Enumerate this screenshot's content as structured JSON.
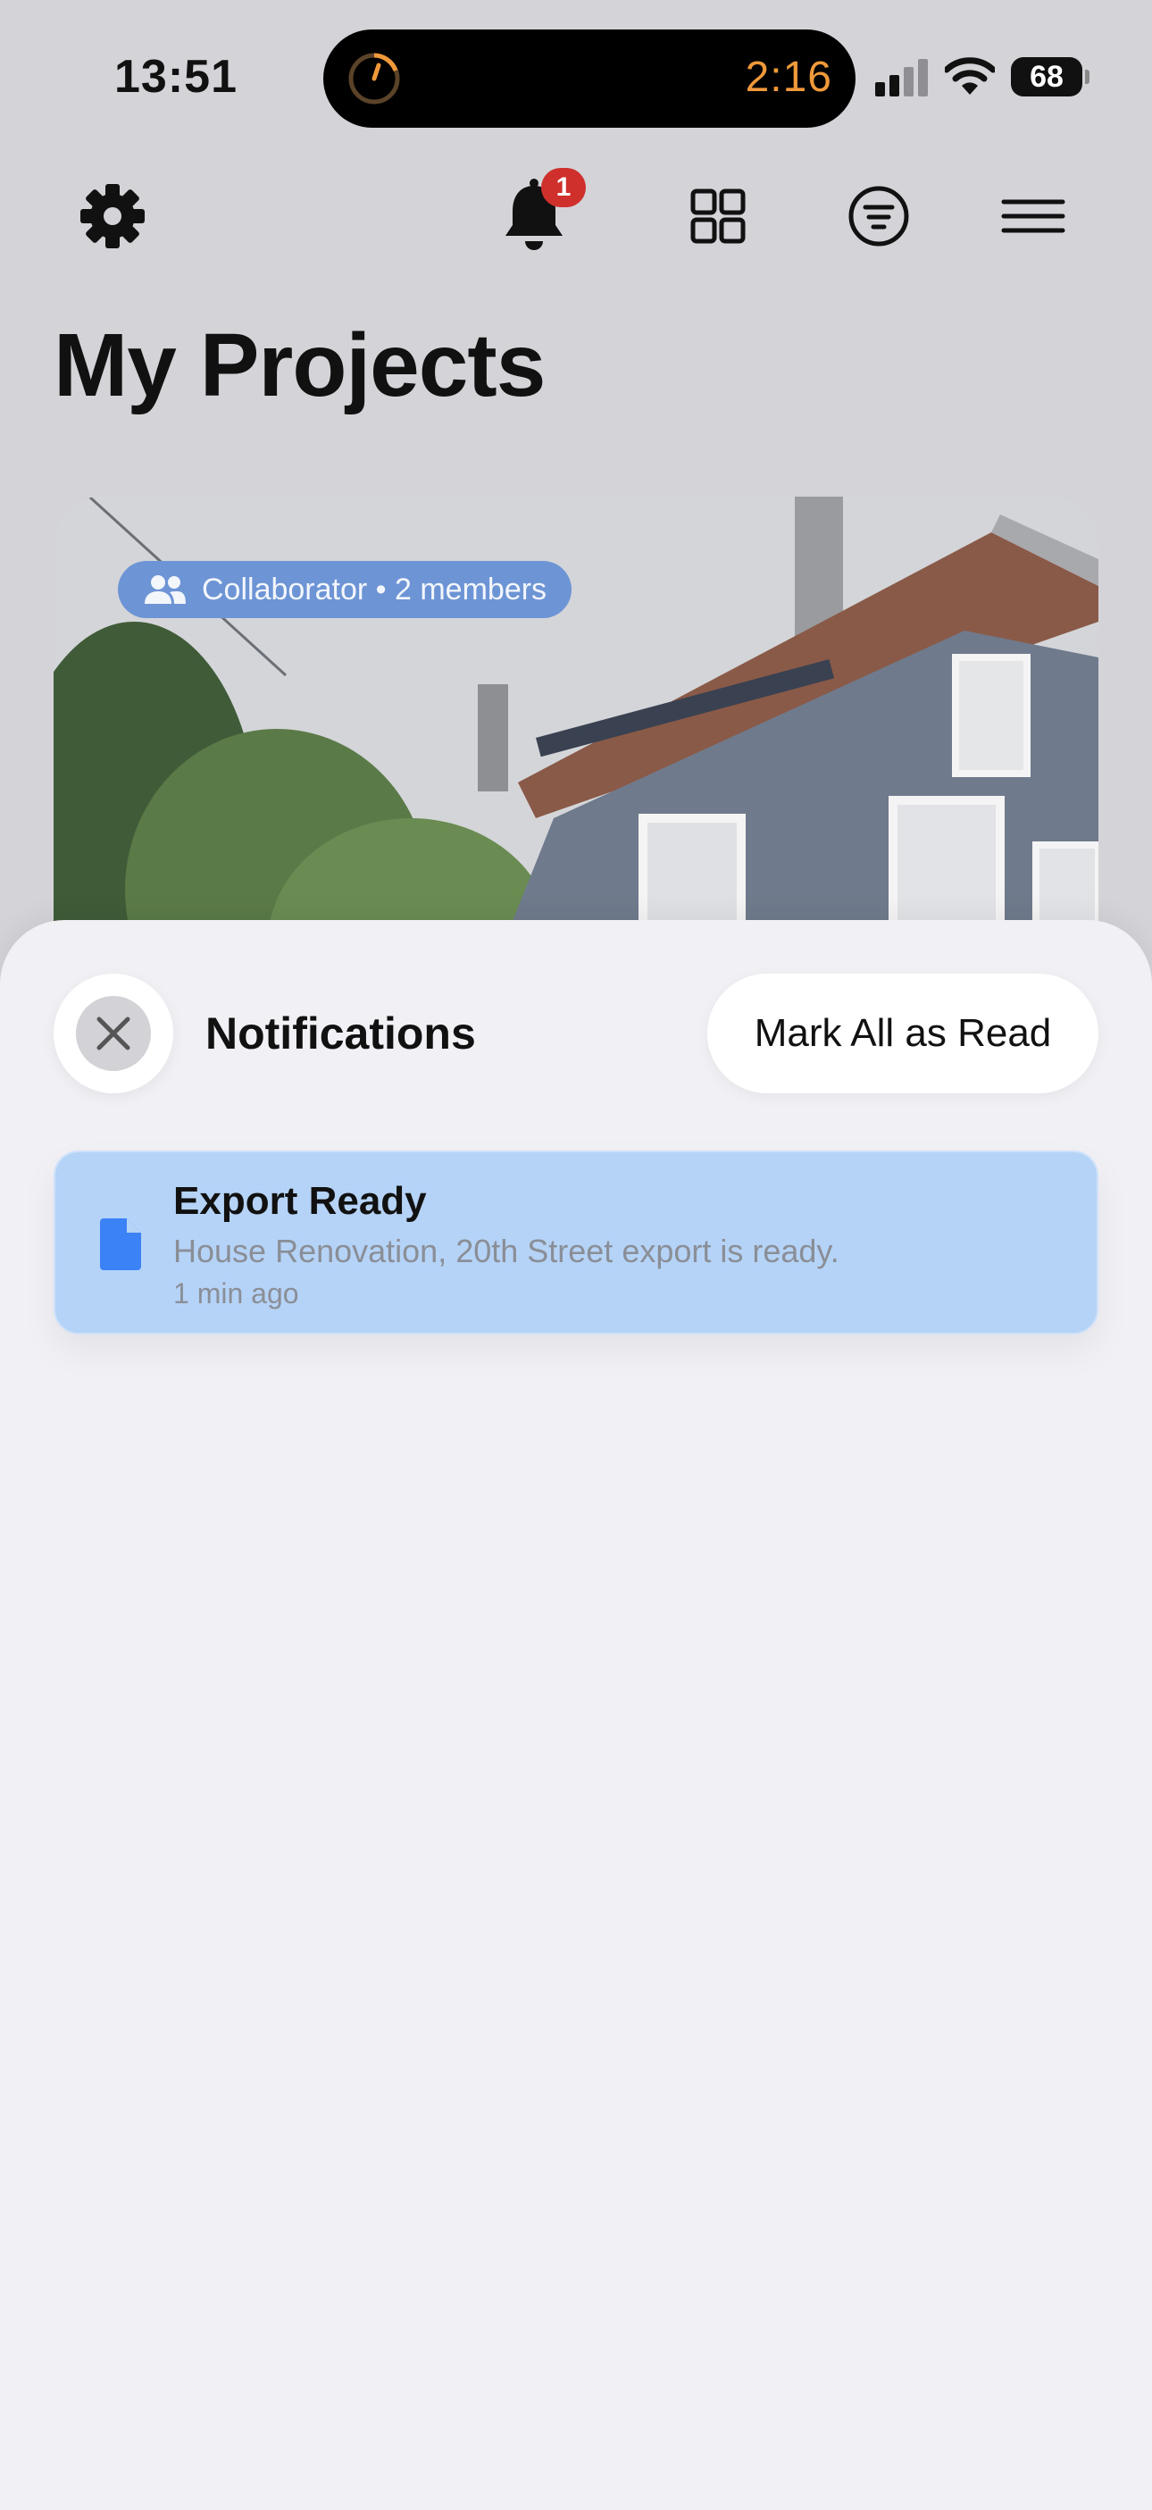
{
  "status_bar": {
    "time": "13:51",
    "island_timer": "2:16",
    "battery": "68",
    "icons": [
      "timer-icon",
      "signal-icon",
      "wifi-icon",
      "battery-icon"
    ]
  },
  "toolbar": {
    "icons": [
      "gear-icon",
      "bell-icon",
      "grid-icon",
      "filter-icon",
      "menu-icon"
    ],
    "notification_badge": "1"
  },
  "page": {
    "title": "My Projects"
  },
  "project_card": {
    "collaborator_label": "Collaborator • 2 members",
    "icon": "people-icon"
  },
  "notifications_sheet": {
    "title": "Notifications",
    "mark_all_label": "Mark All as Read",
    "close_icon": "close-icon",
    "items": [
      {
        "title": "Export Ready",
        "body": "House Renovation, 20th Street export is ready.",
        "time": "1 min ago",
        "icon": "document-icon"
      }
    ]
  },
  "colors": {
    "accent": "#3b82f6",
    "badge": "#d0302c",
    "notification_card": "#b5d3f6",
    "timer": "#f0993a"
  }
}
